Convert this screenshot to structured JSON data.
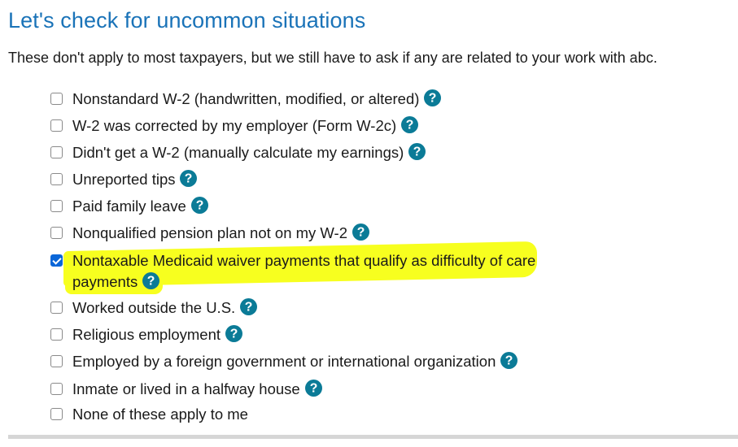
{
  "page": {
    "title": "Let's check for uncommon situations",
    "subtitle": "These don't apply to most taxpayers, but we still have to ask if any are related to your work with abc."
  },
  "help_icon": {
    "icon": "question-circle-icon",
    "color": "#0b7b97"
  },
  "colors": {
    "title": "#1a73b8",
    "checkbox_checked": "#0a66d8",
    "highlight": "#f7ff1f"
  },
  "options": [
    {
      "label": "Nonstandard W-2 (handwritten, modified, or altered)",
      "checked": false,
      "has_help": true
    },
    {
      "label": "W-2 was corrected by my employer (Form W-2c)",
      "checked": false,
      "has_help": true
    },
    {
      "label": "Didn't get a W-2 (manually calculate my earnings)",
      "checked": false,
      "has_help": true
    },
    {
      "label": "Unreported tips",
      "checked": false,
      "has_help": true
    },
    {
      "label": "Paid family leave",
      "checked": false,
      "has_help": true
    },
    {
      "label": "Nonqualified pension plan not on my W-2",
      "checked": false,
      "has_help": true
    },
    {
      "label_line1": "Nontaxable Medicaid waiver payments that qualify as difficulty of care",
      "label_line2": "payments",
      "checked": true,
      "has_help": true,
      "highlighted": true
    },
    {
      "label": "Worked outside the U.S.",
      "checked": false,
      "has_help": true
    },
    {
      "label": "Religious employment",
      "checked": false,
      "has_help": true
    },
    {
      "label": "Employed by a foreign government or international organization",
      "checked": false,
      "has_help": true
    },
    {
      "label": "Inmate or lived in a halfway house",
      "checked": false,
      "has_help": true
    },
    {
      "label": "None of these apply to me",
      "checked": false,
      "has_help": false
    }
  ]
}
